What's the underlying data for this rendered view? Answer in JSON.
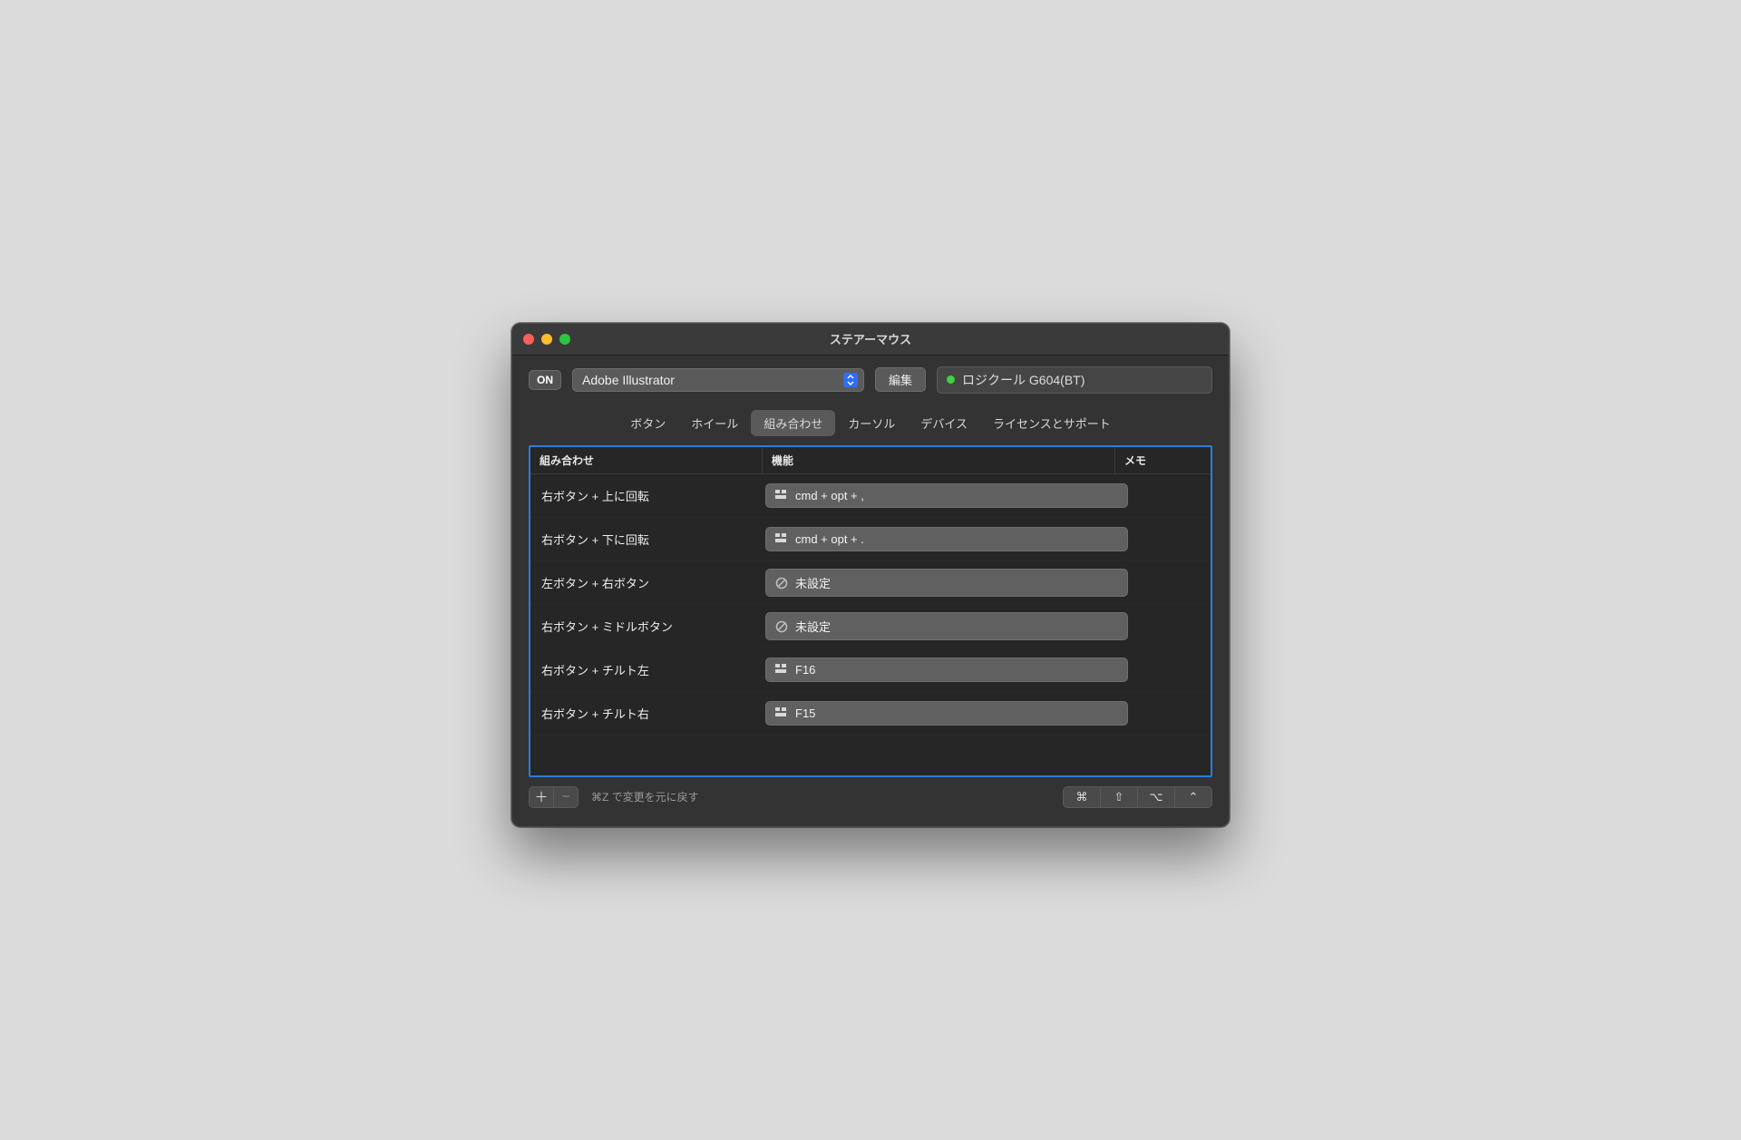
{
  "window": {
    "title": "ステアーマウス"
  },
  "toolbar": {
    "on": "ON",
    "app": "Adobe Illustrator",
    "edit": "編集",
    "device": "ロジクール G604(BT)"
  },
  "tabs": [
    "ボタン",
    "ホイール",
    "組み合わせ",
    "カーソル",
    "デバイス",
    "ライセンスとサポート"
  ],
  "active_tab_index": 2,
  "columns": {
    "combo": "組み合わせ",
    "function": "機能",
    "memo": "メモ"
  },
  "rows": [
    {
      "combo": "右ボタン + 上に回転",
      "icon": "shortcut",
      "function": "cmd + opt + ,"
    },
    {
      "combo": "右ボタン + 下に回転",
      "icon": "shortcut",
      "function": "cmd + opt + ."
    },
    {
      "combo": "左ボタン + 右ボタン",
      "icon": "none",
      "function": "未設定"
    },
    {
      "combo": "右ボタン + ミドルボタン",
      "icon": "none",
      "function": "未設定"
    },
    {
      "combo": "右ボタン + チルト左",
      "icon": "shortcut",
      "function": "F16"
    },
    {
      "combo": "右ボタン + チルト右",
      "icon": "shortcut",
      "function": "F15"
    }
  ],
  "footer": {
    "undo": "⌘Z で変更を元に戻す",
    "mods": [
      "⌘",
      "⇧",
      "⌥",
      "⌃"
    ]
  }
}
